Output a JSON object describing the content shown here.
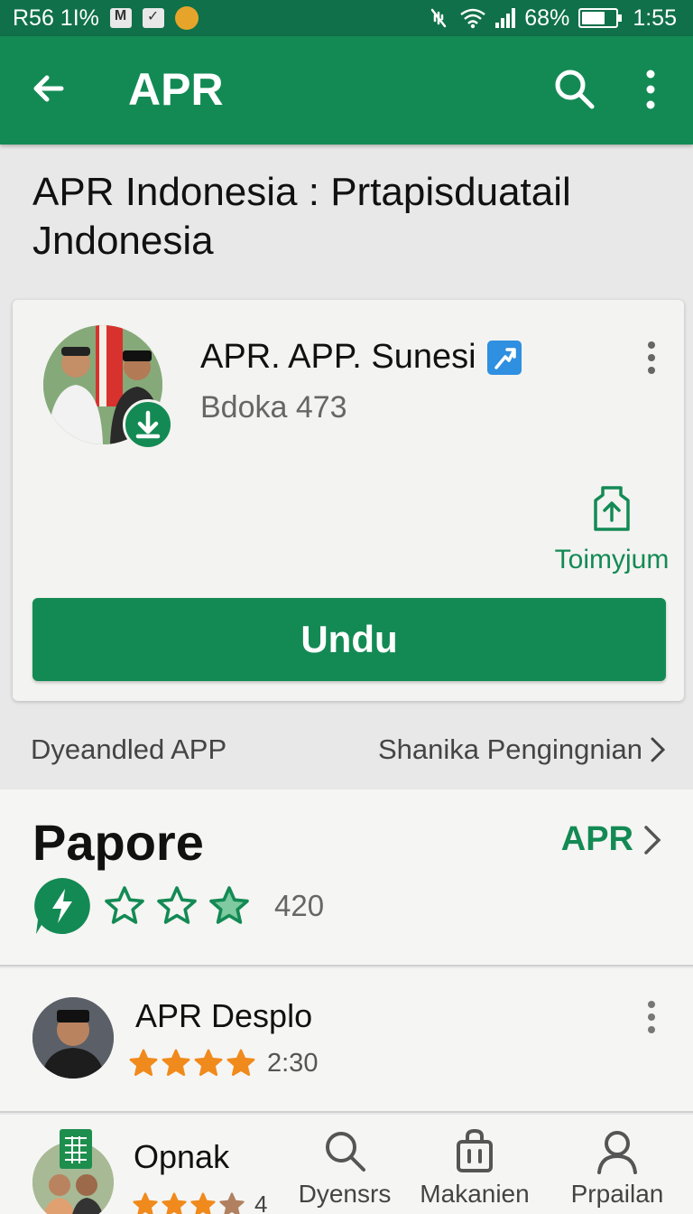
{
  "status_bar": {
    "left_text": "R56 1I%",
    "battery": "68%",
    "battery_level": 0.68,
    "time": "1:55"
  },
  "app_bar": {
    "title": "APR",
    "icons": [
      "arrow-back-icon",
      "search-icon",
      "more-vert-icon"
    ]
  },
  "page": {
    "heading": "APR Indonesia : Prtapisduatail Jndonesia"
  },
  "app_card": {
    "name": "APR. APP. Sunesi",
    "subtitle": "Bdoka 473",
    "share_label": "Toimyjum",
    "download_label": "Undu"
  },
  "links": {
    "left": "Dyeandled APP",
    "right": "Shanika Pengingnian"
  },
  "section": {
    "title": "Papore",
    "link": "APR",
    "rating_count": "420",
    "stars_filled": 1,
    "stars_total": 3
  },
  "list_item": {
    "title": "APR Desplo",
    "meta": "2:30",
    "rating": 4.5
  },
  "bottom_item": {
    "title": "Opnak",
    "count": "4",
    "rating": 4
  },
  "bottom_nav": [
    {
      "label": "Dyensrs",
      "icon": "search-icon"
    },
    {
      "label": "Makanien",
      "icon": "shopping-bag-icon"
    },
    {
      "label": "Prpailan",
      "icon": "profile-icon"
    }
  ],
  "colors": {
    "primary": "#138a54",
    "status_bar": "#10704a",
    "star": "#f08a1c"
  }
}
